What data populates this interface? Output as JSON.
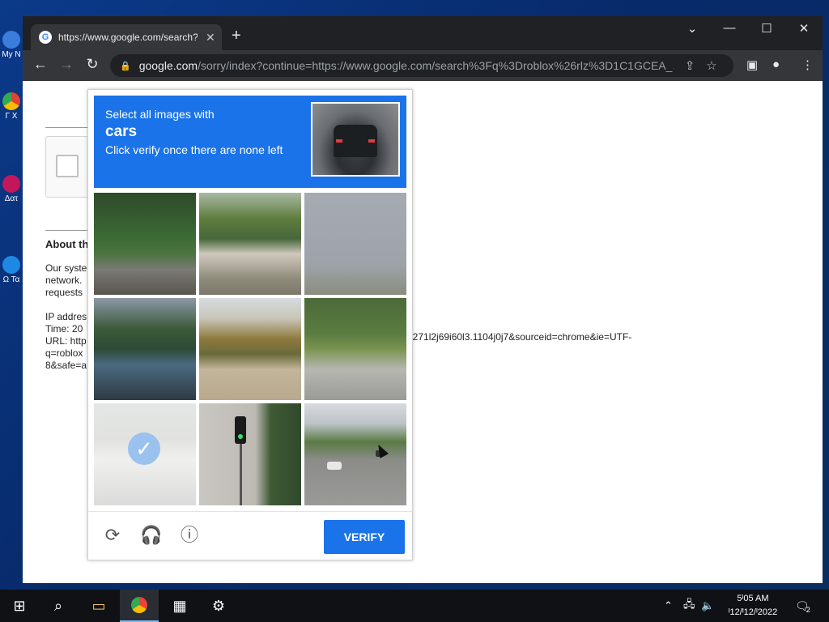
{
  "desktop": {
    "icons": [
      {
        "label": "My N",
        "color": "#3b7ddd"
      },
      {
        "label": "Γ X",
        "color": "#e34133"
      },
      {
        "label": "Δατ",
        "color": "#c2185b"
      },
      {
        "label": "Ω Τα",
        "color": "#1e88e5"
      }
    ]
  },
  "browser": {
    "tab_title": "https://www.google.com/search?",
    "tab_close": "✕",
    "new_tab": "+",
    "window_controls": {
      "menu": "⌄",
      "minimize": "—",
      "maximize": "☐",
      "close": "✕"
    },
    "url_domain": "google.com",
    "url_rest": "/sorry/index?continue=https://www.google.com/search%3Fq%3Droblox%26rlz%3D1C1GCEA_..."
  },
  "page": {
    "about_heading": "About th",
    "para_lines": [
      "Our syste",
      "network.",
      "requests"
    ],
    "info_lines": [
      "IP addres",
      "Time: 20",
      "URL: http",
      "q=roblox",
      "8&safe=a"
    ],
    "url_tail": "i271l2j69i60l3.1104j0j7&sourceid=chrome&ie=UTF-"
  },
  "captcha": {
    "line1": "Select all images with",
    "target": "cars",
    "line3": "Click verify once there are none left",
    "verify_label": "VERIFY",
    "tiles": [
      {
        "desc": "forest-guardrail",
        "selected": false
      },
      {
        "desc": "palm-trees-wall",
        "selected": false
      },
      {
        "desc": "noise-grass",
        "selected": false
      },
      {
        "desc": "bridge-trees",
        "selected": false
      },
      {
        "desc": "autumn-trees-field",
        "selected": false
      },
      {
        "desc": "road-grass",
        "selected": false
      },
      {
        "desc": "car-street",
        "selected": true
      },
      {
        "desc": "traffic-light",
        "selected": false
      },
      {
        "desc": "street-cars-buildings",
        "selected": false
      }
    ]
  },
  "taskbar": {
    "apps": [
      "start",
      "search",
      "file-explorer",
      "chrome",
      "photos",
      "settings"
    ],
    "time": "5ᴵ05 AM",
    "date": "ᴵ12/ᴵ12/ᴵ2022",
    "notifications": "2"
  }
}
